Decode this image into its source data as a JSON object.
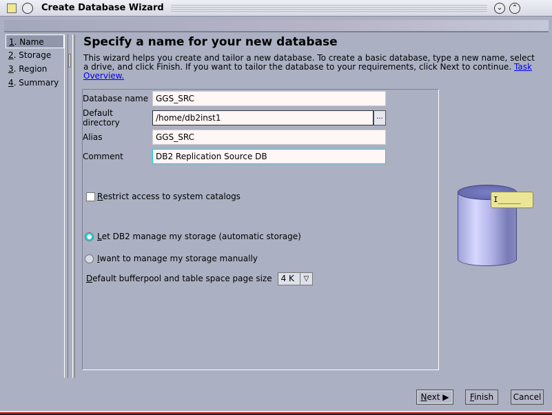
{
  "window": {
    "title": "Create Database Wizard",
    "minimize_icon": "chevron-down",
    "maximize_icon": "chevron-up"
  },
  "steps": [
    {
      "num": "1",
      "label": ". Name"
    },
    {
      "num": "2",
      "label": ". Storage"
    },
    {
      "num": "3",
      "label": ". Region"
    },
    {
      "num": "4",
      "label": ". Summary"
    }
  ],
  "page": {
    "heading": "Specify a name for your new database",
    "intro": "This wizard helps you create and tailor a new database. To create a basic database, type a new name, select a drive, and click Finish. If you want to tailor the database to your requirements, click Next to continue. ",
    "link": "Task Overview."
  },
  "form": {
    "db_name_label": "Database name",
    "db_name": "GGS_SRC",
    "dir_label": "Default directory",
    "dir": "/home/db2inst1",
    "browse": "...",
    "alias_label": "Alias",
    "alias": "GGS_SRC",
    "comment_label": "Comment",
    "comment": "DB2 Replication Source DB",
    "restrict_key": "R",
    "restrict_label": "estrict access to system catalogs",
    "restrict_checked": false,
    "auto_key": "L",
    "auto_label": "et DB2 manage my storage (automatic storage)",
    "manual_key": "I",
    "manual_label": " want to manage my storage manually",
    "storage_selected": "auto",
    "pagesize_key": "D",
    "pagesize_label": "efault bufferpool and table space page size",
    "pagesize": "4 K"
  },
  "tooltip": "I_____",
  "buttons": {
    "next_key": "N",
    "next": "ext",
    "finish_key": "F",
    "finish": "inish",
    "cancel": "Cancel"
  }
}
